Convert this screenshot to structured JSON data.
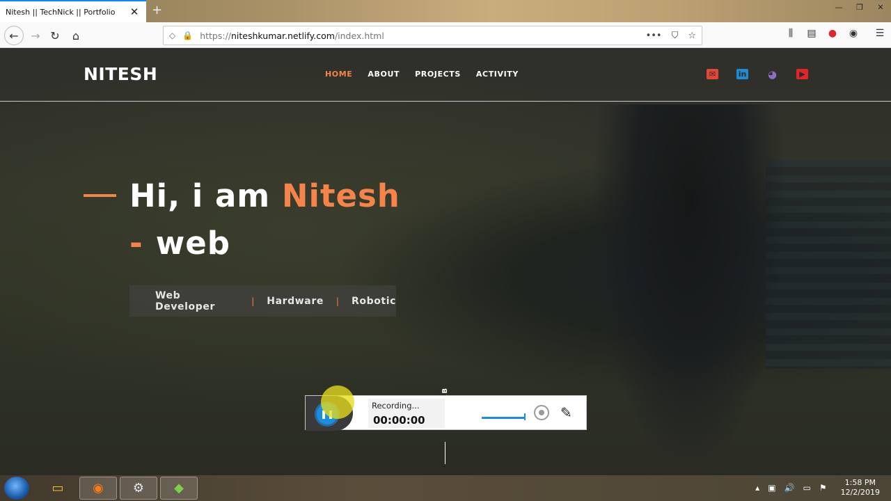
{
  "browser": {
    "tab_title": "Nitesh || TechNick || Portfolio",
    "url_prefix": "https://",
    "url_host": "niteshkumar.netlify.com",
    "url_path": "/index.html"
  },
  "site": {
    "logo": "NITESH",
    "menu": [
      "HOME",
      "ABOUT",
      "PROJECTS",
      "ACTIVITY"
    ],
    "active_menu": "HOME",
    "hero_prefix": "Hi, i am ",
    "hero_name": "Nitesh",
    "hero_hyphen": "-",
    "hero_line2": "web",
    "skills": [
      "Web Developer",
      "Hardware",
      "Robotic"
    ],
    "skill_separator": "|",
    "scroll_label": "AB"
  },
  "recorder": {
    "status": "Recording...",
    "time": "00:00:00"
  },
  "taskbar": {
    "time": "1:58 PM",
    "date": "12/2/2019"
  },
  "colors": {
    "accent": "#f4844a",
    "email": "#e0463a",
    "linkedin": "#1f8bd0",
    "github": "#8b6fc4",
    "youtube": "#e0252b"
  }
}
